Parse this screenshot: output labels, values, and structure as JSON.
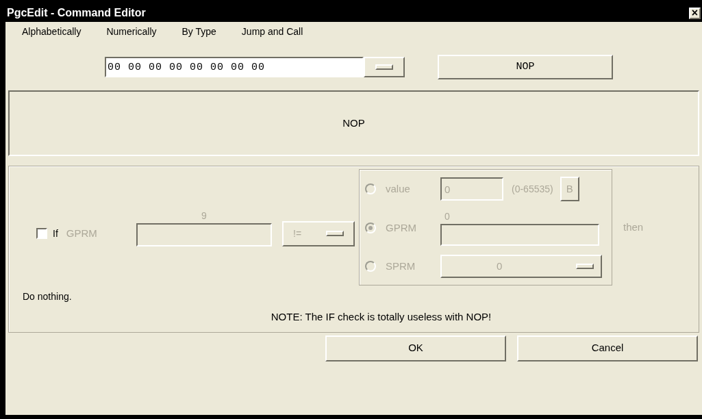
{
  "window": {
    "title": "PgcEdit - Command Editor",
    "close": "×"
  },
  "menu": [
    "Alphabetically",
    "Numerically",
    "By Type",
    "Jump and Call"
  ],
  "command_bytes": "00 00 00 00 00 00 00 00",
  "command_button": "NOP",
  "command_display": "NOP",
  "condition": {
    "disabled": true,
    "checkbox": {
      "label": "If",
      "checked": false
    },
    "register_label": "GPRM",
    "register_value": "9",
    "operator": "!=",
    "options": [
      {
        "kind": "value",
        "label": "value",
        "selected": false,
        "value": "0",
        "range": "(0-65535)",
        "button": "B"
      },
      {
        "kind": "register",
        "label": "GPRM",
        "selected": true,
        "value": "0"
      },
      {
        "kind": "dropdown",
        "label": "SPRM",
        "selected": false,
        "value": "0"
      }
    ],
    "then_label": "then"
  },
  "description": "Do nothing.",
  "note": "NOTE: The IF check is totally useless with NOP!",
  "buttons": [
    "OK",
    "Cancel"
  ]
}
